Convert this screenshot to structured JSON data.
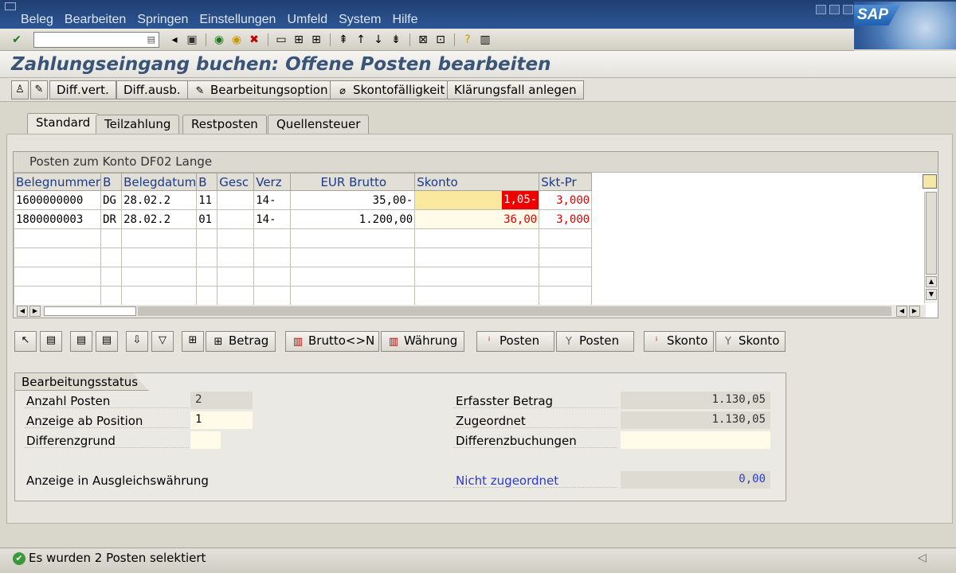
{
  "menubar": {
    "items": [
      "Beleg",
      "Bearbeiten",
      "Springen",
      "Einstellungen",
      "Umfeld",
      "System",
      "Hilfe"
    ],
    "logo": "SAP"
  },
  "toolbar": {
    "command_field_value": "",
    "icons": [
      "enter-icon",
      "back-icon",
      "save-icon",
      "back-green-icon",
      "exit-icon",
      "cancel-icon",
      "print-icon",
      "find-icon",
      "find-next-icon",
      "first-page-icon",
      "prev-page-icon",
      "next-page-icon",
      "last-page-icon",
      "new-session-icon",
      "shortcut-icon",
      "help-icon",
      "layout-icon"
    ]
  },
  "title": "Zahlungseingang buchen: Offene Posten bearbeiten",
  "app_toolbar": {
    "buttons": [
      "Diff.vert.",
      "Diff.ausb.",
      "Bearbeitungsoption",
      "Skontofälligkeit",
      "Klärungsfall anlegen"
    ]
  },
  "tabs": [
    "Standard",
    "Teilzahlung",
    "Restposten",
    "Quellensteuer"
  ],
  "table": {
    "caption": "Posten zum Konto DF02 Lange",
    "columns": [
      "Belegnummer",
      "B",
      "Belegdatum",
      "B",
      "Gesc",
      "Verz",
      "EUR Brutto",
      "Skonto",
      "Skt-Pr"
    ],
    "rows": [
      [
        "1600000000",
        "DG",
        "28.02.2",
        "11",
        "",
        "14-",
        "35,00-",
        "1,05-",
        "3,000"
      ],
      [
        "1800000003",
        "DR",
        "28.02.2",
        "01",
        "",
        "14-",
        "1.200,00",
        "36,00",
        "3,000"
      ]
    ]
  },
  "table_buttons": [
    "Betrag",
    "Brutto<>N",
    "Währung",
    "Posten",
    "Posten",
    "Skonto",
    "Skonto"
  ],
  "status_group": {
    "title": "Bearbeitungsstatus",
    "left": [
      {
        "label": "Anzahl Posten",
        "value": "2"
      },
      {
        "label": "Anzeige ab Position",
        "value": "1"
      },
      {
        "label": "Differenzgrund",
        "value": ""
      },
      {
        "label": "Anzeige in Ausgleichswährung"
      }
    ],
    "right": [
      {
        "label": "Erfasster Betrag",
        "value": "1.130,05"
      },
      {
        "label": "Zugeordnet",
        "value": "1.130,05"
      },
      {
        "label": "Differenzbuchungen",
        "value": ""
      },
      {
        "label": "Nicht zugeordnet",
        "value": "0,00"
      }
    ]
  },
  "status_message": "Es wurden 2 Posten selektiert",
  "colors": {
    "menubar": "#2d5694",
    "title_text": "#3a5478",
    "highlight_red": "#ee0000",
    "highlight_yellow": "#fbe89f",
    "link_blue": "#2a3bd0",
    "ok_green": "#3a9a3a"
  }
}
